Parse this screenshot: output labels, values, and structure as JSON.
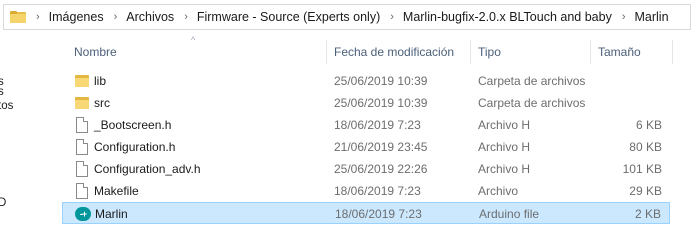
{
  "breadcrumb": {
    "items": [
      {
        "label": "Imágenes"
      },
      {
        "label": "Archivos"
      },
      {
        "label": "Firmware - Source (Experts only)"
      },
      {
        "label": "Marlin-bugfix-2.0.x BLTouch and baby"
      },
      {
        "label": "Marlin"
      }
    ],
    "separator": "›"
  },
  "nav_pane": {
    "fragments": [
      "s",
      "s",
      "tos",
      "D"
    ]
  },
  "columns": {
    "name": "Nombre",
    "date": "Fecha de modificación",
    "type": "Tipo",
    "size": "Tamaño",
    "sort_indicator": "^"
  },
  "files": [
    {
      "name": "lib",
      "date": "25/06/2019 10:39",
      "type": "Carpeta de archivos",
      "size": "",
      "icon": "folder-icon",
      "selected": false
    },
    {
      "name": "src",
      "date": "25/06/2019 10:39",
      "type": "Carpeta de archivos",
      "size": "",
      "icon": "folder-icon",
      "selected": false
    },
    {
      "name": "_Bootscreen.h",
      "date": "18/06/2019 7:23",
      "type": "Archivo H",
      "size": "6 KB",
      "icon": "document-icon",
      "selected": false
    },
    {
      "name": "Configuration.h",
      "date": "21/06/2019 23:45",
      "type": "Archivo H",
      "size": "80 KB",
      "icon": "document-icon",
      "selected": false
    },
    {
      "name": "Configuration_adv.h",
      "date": "25/06/2019 22:26",
      "type": "Archivo H",
      "size": "101 KB",
      "icon": "document-icon",
      "selected": false
    },
    {
      "name": "Makefile",
      "date": "18/06/2019 7:23",
      "type": "Archivo",
      "size": "29 KB",
      "icon": "document-icon",
      "selected": false
    },
    {
      "name": "Marlin",
      "date": "18/06/2019 7:23",
      "type": "Arduino file",
      "size": "2 KB",
      "icon": "arduino-icon",
      "selected": true
    }
  ],
  "colors": {
    "selection_fill": "#cce8ff",
    "selection_border": "#99d1ff",
    "header_text": "#4c607a",
    "folder": "#f8d775",
    "arduino": "#00979c"
  }
}
